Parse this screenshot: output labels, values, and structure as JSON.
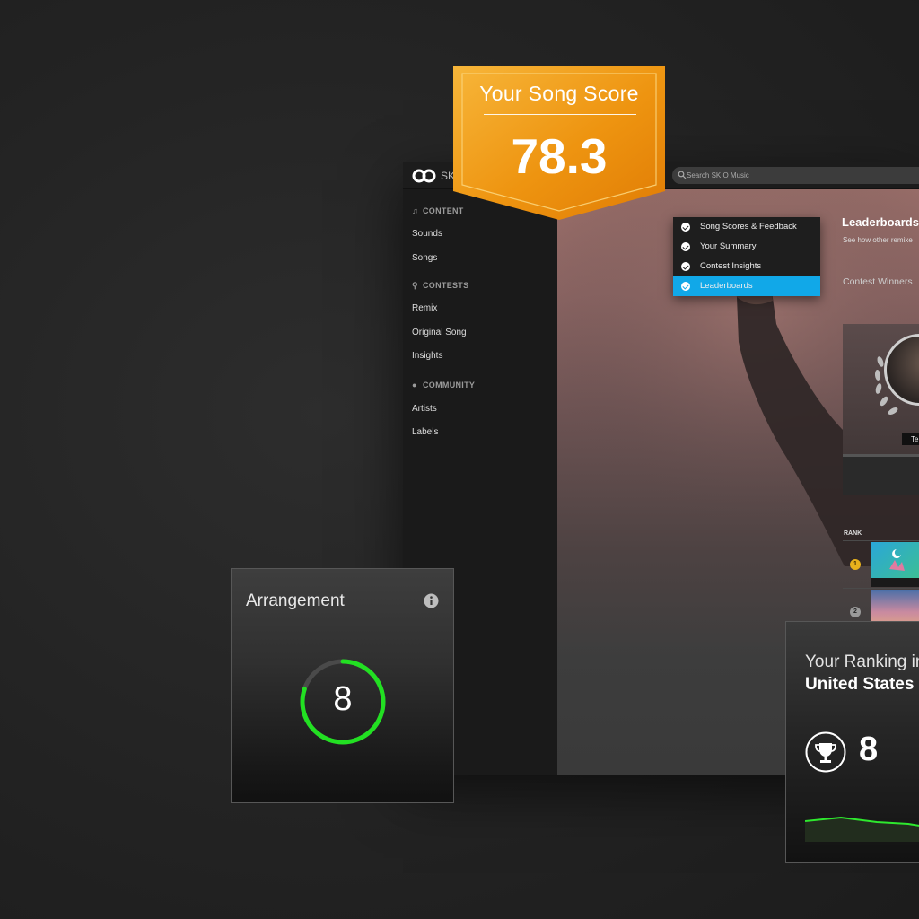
{
  "app": {
    "brand": "SK",
    "search_placeholder": "Search SKIO Music"
  },
  "sidebar": {
    "sections": [
      {
        "title": "CONTENT",
        "items": [
          "Sounds",
          "Songs"
        ]
      },
      {
        "title": "CONTESTS",
        "items": [
          "Remix",
          "Original Song",
          "Insights"
        ]
      },
      {
        "title": "COMMUNITY",
        "items": [
          "Artists",
          "Labels"
        ]
      }
    ]
  },
  "dropdown": {
    "items": [
      "Song Scores & Feedback",
      "Your Summary",
      "Contest Insights",
      "Leaderboards"
    ],
    "active_index": 3
  },
  "leaderboard": {
    "title": "Leaderboards",
    "subtitle": "See how other remixe",
    "contest_label": "Contest Winners",
    "winner_name": "Te",
    "rank_header": "RANK",
    "ranks": [
      "1",
      "2"
    ]
  },
  "badge": {
    "title": "Your Song Score",
    "score": "78.3"
  },
  "arrangement": {
    "title": "Arrangement",
    "value": "8",
    "progress": 0.8
  },
  "ranking": {
    "title": "Your Ranking in",
    "country": "United States",
    "value": "8"
  },
  "colors": {
    "accent_green": "#22e022",
    "badge_orange": "#f29a12",
    "dropdown_active": "#11a8e8",
    "gold": "#e8b21c"
  }
}
